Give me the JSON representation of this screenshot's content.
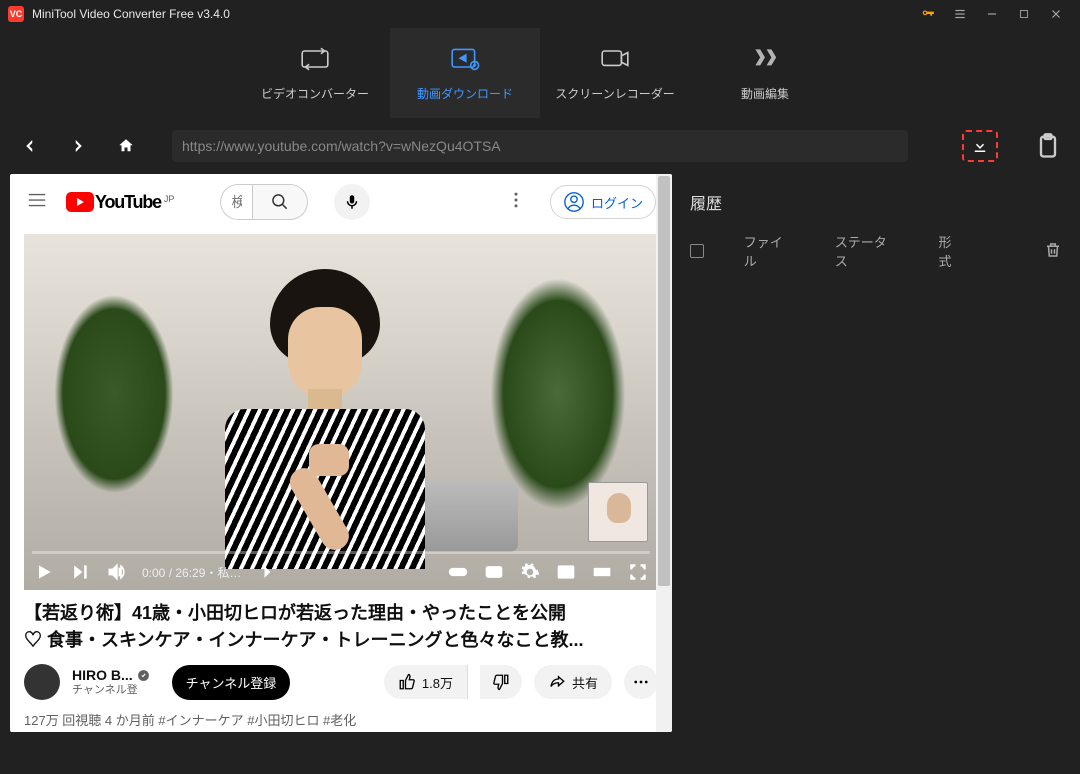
{
  "titlebar": {
    "app_icon_text": "VC",
    "title": "MiniTool Video Converter Free v3.4.0"
  },
  "tabs": [
    {
      "label": "ビデオコンバーター"
    },
    {
      "label": "動画ダウンロード"
    },
    {
      "label": "スクリーンレコーダー"
    },
    {
      "label": "動画編集"
    }
  ],
  "nav": {
    "url": "https://www.youtube.com/watch?v=wNezQu4OTSA"
  },
  "youtube": {
    "brand": "YouTube",
    "region": "JP",
    "search_placeholder": "検",
    "login": "ログイン",
    "player": {
      "time": "0:00 / 26:29・私…"
    },
    "title_line1": "【若返り術】41歳・小田切ヒロが若返った理由・やったことを公開",
    "title_line2": "♡ 食事・スキンケア・インナーケア・トレーニングと色々なこと教...",
    "channel": {
      "name": "HIRO B...",
      "sub": "チャンネル登",
      "subscribe": "チャンネル登録"
    },
    "like": "1.8万",
    "share": "共有",
    "views": "127万 回視聴  4 か月前  #インナーケア #小田切ヒロ #老化"
  },
  "history": {
    "title": "履歴",
    "cols": {
      "file": "ファイル",
      "status": "ステータス",
      "format": "形式"
    }
  }
}
